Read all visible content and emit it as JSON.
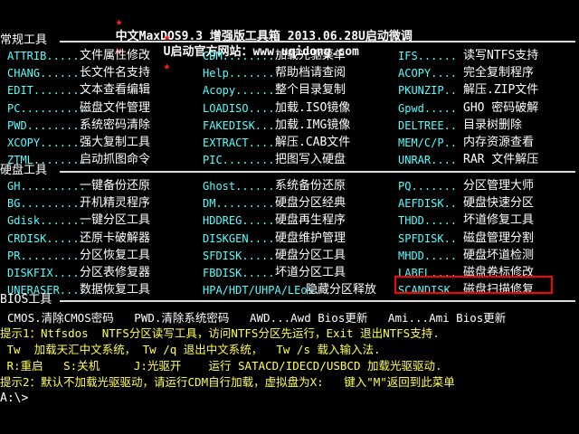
{
  "header": {
    "star": "★",
    "title1": "中文MaxDOS9.3 增强版工具箱 2013.06.28U启动微调",
    "title2": "U启动官方网站：www.uqidong.com"
  },
  "sections": {
    "common": "常规工具",
    "disk": "硬盘工具",
    "bios": "BIOS工具"
  },
  "common_tools": [
    [
      "ATTRIB......",
      "文件属性修改",
      "CDM........",
      "加载光驱菜单",
      "IFS......",
      "读写NTFS支持"
    ],
    [
      "CHANG.......",
      "长文件名支持",
      "Help.......",
      "帮助档请查阅",
      "ACOPY....",
      "完全复制程序"
    ],
    [
      "EDIT........",
      "文本查看编辑",
      "Acopy......",
      "整个目录复制",
      "PKUNZIP..",
      "解压.ZIP文件"
    ],
    [
      "PC..........",
      "磁盘文件管理",
      "LOADISO....",
      "加载.ISO镜像",
      "Gpwd.....",
      "GHO 密码破解"
    ],
    [
      "PWD.........",
      "系统密码清除",
      "FAKEDISK...",
      "加载.IMG镜像",
      "DELTREE..",
      "目录树删除"
    ],
    [
      "XCOPY.......",
      "强大复制工具",
      "EXTRACT....",
      "解压.CAB文件",
      "MEM/C/P..",
      "内存资源查看"
    ],
    [
      "ZTML........",
      "启动抓图命令",
      "PIC........",
      "把图写入硬盘",
      "UNRAR....",
      "RAR 文件解压"
    ]
  ],
  "disk_tools": [
    [
      "GH..........",
      "一键备份还原",
      "Ghost......",
      "系统备份还原",
      "PQ.......",
      "分区管理大师"
    ],
    [
      "BG..........",
      "开机精灵程序",
      "DM.........",
      "硬盘分区经典",
      "AEFDISK..",
      "硬盘快速分区"
    ],
    [
      "Gdisk.......",
      "一键分区工具",
      "HDDREG.....",
      "硬盘再生程序",
      "THDD.....",
      "坏道修复工具"
    ],
    [
      "CRDISK......",
      "还原卡破解器",
      "DISKGEN....",
      "硬盘维护管理",
      "SPFDISK..",
      "磁盘管理分割"
    ],
    [
      "PR..........",
      "分区恢复工具",
      "SFDISK.....",
      "硬盘分区工具",
      "MHDD.....",
      "硬盘坏道检测"
    ],
    [
      "DISKFIX.....",
      "分区表修复器",
      "FBDISK.....",
      "坏道分区工具",
      "LABEL....",
      "磁盘卷标修改"
    ],
    [
      "UNERASER....",
      "数据恢复工具",
      "HPA/HDT/UHPA/LEos.",
      "隐藏分区释放",
      "SCANDISK.",
      "磁盘扫描修复"
    ]
  ],
  "bios_line": "CMOS.清除CMOS密码   PWD.清除系统密码   AWD...Awd Bios更新   Ami...Ami Bios更新",
  "hints": {
    "h1": "提示1：Ntfsdos  NTFS分区读写工具，访问NTFS分区先运行，Exit 退出NTFS支持.",
    "h2": " Tw  加载天汇中文系统， Tw /q 退出中文系统，  Tw /s 载入输入法.",
    "h3": " R:重启   S:关机     J:光驱开    运行 SATACD/IDECD/USBCD 加载光驱驱动.",
    "h4": "提示2：默认不加载光驱驱动，请运行CDM自行加载，虚拟盘为X:   键入\"M\"返回到此菜单",
    "prompt": "A:\\>"
  }
}
